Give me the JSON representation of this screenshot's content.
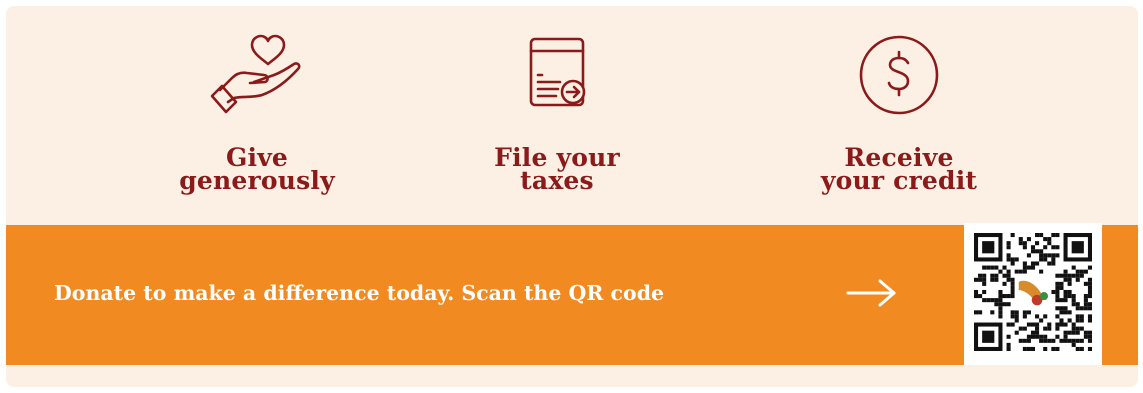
{
  "steps": [
    {
      "icon": "hand-heart-icon",
      "label": "Give\ngenerously"
    },
    {
      "icon": "tax-form-icon",
      "label": "File your\ntaxes"
    },
    {
      "icon": "dollar-circle-icon",
      "label": "Receive\nyour credit"
    }
  ],
  "banner": {
    "cta_text": "Donate to make a difference today. Scan the QR code",
    "arrow_icon": "arrow-right-icon",
    "qr_icon": "donation-qr-code-icon"
  },
  "colors": {
    "background": "#fcefe3",
    "accent_dark": "#8b1a1a",
    "banner": "#f28a22",
    "banner_text": "#ffffff"
  }
}
